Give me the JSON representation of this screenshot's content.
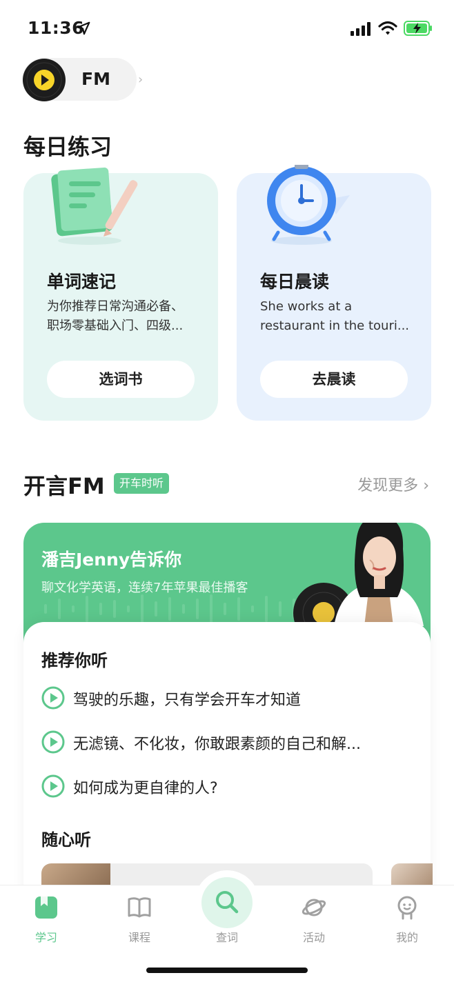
{
  "status_bar": {
    "time": "11:36"
  },
  "fm_entry": {
    "label": "FM",
    "chevron": "›"
  },
  "daily": {
    "title": "每日练习",
    "cards": [
      {
        "title": "单词速记",
        "desc_line1": "为你推荐日常沟通必备、",
        "desc_line2": "职场零基础入门、四级...",
        "button": "选词书"
      },
      {
        "title": "每日晨读",
        "desc_line1": "She works at a",
        "desc_line2": "restaurant in the touri...",
        "button": "去晨读"
      }
    ]
  },
  "fm_section": {
    "title": "开言FM",
    "tag": "开车时听",
    "more": "发现更多",
    "more_chevron": "›",
    "banner": {
      "title": "潘吉Jenny告诉你",
      "subtitle": "聊文化学英语，连续7年苹果最佳播客"
    },
    "recommend": {
      "title": "推荐你听",
      "items": [
        "驾驶的乐趣，只有学会开车才知道",
        "无滤镜、不化妆，你敢跟素颜的自己和解...",
        "如何成为更自律的人?"
      ]
    },
    "casual_title": "随心听"
  },
  "tab_bar": {
    "tabs": [
      {
        "label": "学习",
        "icon": "book-filled-icon",
        "active": true
      },
      {
        "label": "课程",
        "icon": "open-book-icon"
      },
      {
        "label": "查词",
        "icon": "search-icon"
      },
      {
        "label": "活动",
        "icon": "planet-icon"
      },
      {
        "label": "我的",
        "icon": "profile-face-icon"
      }
    ]
  },
  "colors": {
    "accent": "#5cc78c",
    "vocab_card_bg": "#e6f6f3",
    "reading_card_bg": "#e8f1fd",
    "inactive_tab": "#999999"
  }
}
